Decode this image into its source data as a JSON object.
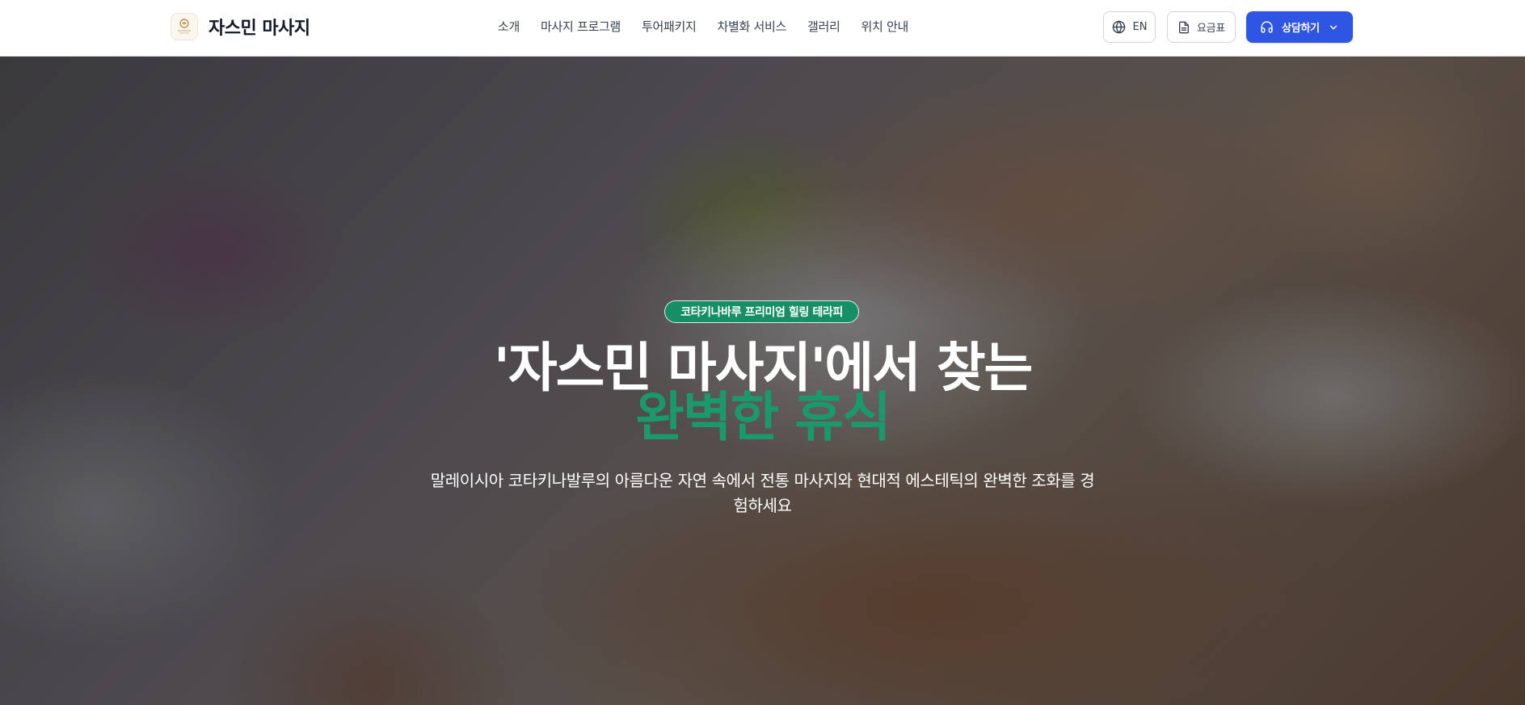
{
  "header": {
    "brand_name": "자스민 마사지",
    "logo_text": "JASMINE",
    "nav": [
      {
        "label": "소개"
      },
      {
        "label": "마사지 프로그램"
      },
      {
        "label": "투어패키지"
      },
      {
        "label": "차별화 서비스"
      },
      {
        "label": "갤러리"
      },
      {
        "label": "위치 안내"
      }
    ],
    "language_label": "EN",
    "language_icon": "globe-icon",
    "price_label": "요금표",
    "price_icon": "document-icon",
    "consult_label": "상담하기",
    "consult_icon": "headset-icon",
    "consult_dropdown_icon": "chevron-down-icon"
  },
  "hero": {
    "badge": "코타키나바루 프리미엄 힐링 테라피",
    "title_line1": "'자스민 마사지'에서 찾는",
    "title_line2": "완벽한 휴식",
    "subtitle": "말레이시아 코타키나발루의 아름다운 자연 속에서 전통 마사지와 현대적 에스테틱의 완벽한 조화를 경험하세요"
  },
  "colors": {
    "accent_blue": "#2f56e3",
    "accent_green": "#1a9a6c",
    "badge_green": "#168f66"
  }
}
